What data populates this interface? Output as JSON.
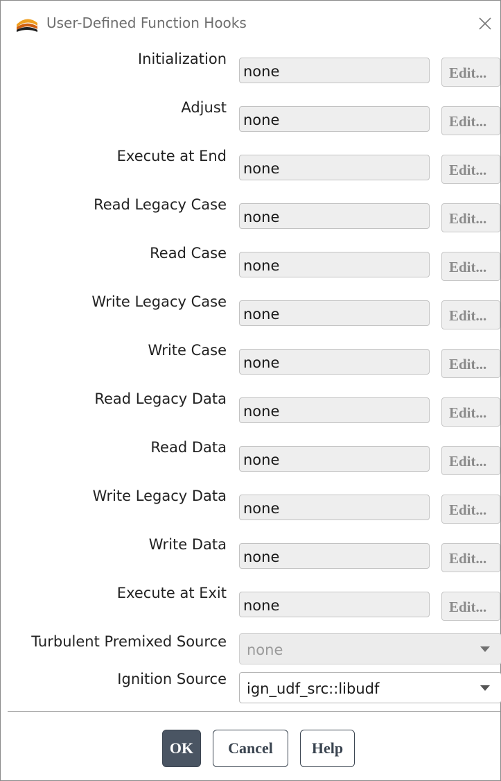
{
  "window": {
    "title": "User-Defined Function Hooks",
    "close_symbol": "×",
    "app_icon": "fluent-logo-icon"
  },
  "hooks": [
    {
      "label": "Initialization",
      "value": "none",
      "edit_label": "Edit..."
    },
    {
      "label": "Adjust",
      "value": "none",
      "edit_label": "Edit..."
    },
    {
      "label": "Execute at End",
      "value": "none",
      "edit_label": "Edit..."
    },
    {
      "label": "Read Legacy Case",
      "value": "none",
      "edit_label": "Edit..."
    },
    {
      "label": "Read Case",
      "value": "none",
      "edit_label": "Edit..."
    },
    {
      "label": "Write Legacy Case",
      "value": "none",
      "edit_label": "Edit..."
    },
    {
      "label": "Write Case",
      "value": "none",
      "edit_label": "Edit..."
    },
    {
      "label": "Read Legacy Data",
      "value": "none",
      "edit_label": "Edit..."
    },
    {
      "label": "Read Data",
      "value": "none",
      "edit_label": "Edit..."
    },
    {
      "label": "Write Legacy Data",
      "value": "none",
      "edit_label": "Edit..."
    },
    {
      "label": "Write Data",
      "value": "none",
      "edit_label": "Edit..."
    },
    {
      "label": "Execute at Exit",
      "value": "none",
      "edit_label": "Edit..."
    }
  ],
  "turbulent_premixed_source": {
    "label": "Turbulent Premixed Source",
    "value": "none",
    "enabled": false
  },
  "ignition_source": {
    "label": "Ignition Source",
    "value": "ign_udf_src::libudf",
    "enabled": true
  },
  "buttons": {
    "ok": "OK",
    "cancel": "Cancel",
    "help": "Help"
  },
  "colors": {
    "ok_button_bg": "#4a5563",
    "button_outline": "#3a4450",
    "field_bg": "#eeeeee"
  }
}
